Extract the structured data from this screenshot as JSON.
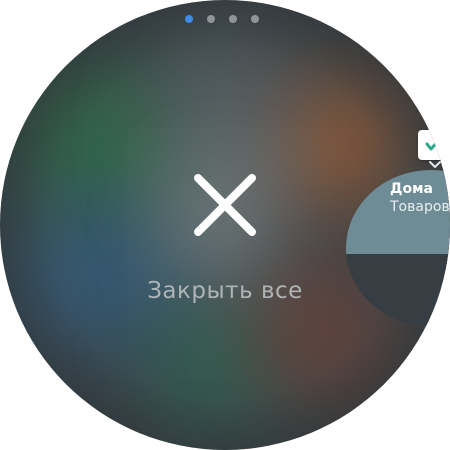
{
  "page_indicator": {
    "count": 4,
    "active_index": 0,
    "active_color": "#3d8be8",
    "inactive_color": "#8f9598"
  },
  "close_all": {
    "icon": "close-x-icon",
    "label": "Закрыть все"
  },
  "recent_app": {
    "icon": "check-app-icon",
    "title": "Дома",
    "subtitle": "Товаров"
  }
}
